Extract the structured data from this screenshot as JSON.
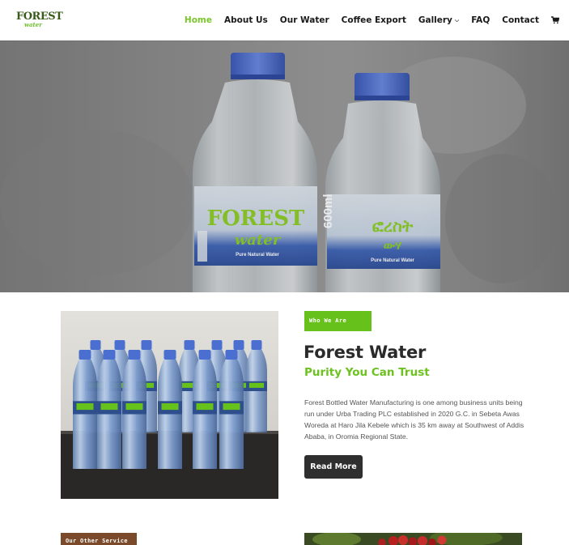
{
  "header": {
    "logo_main": "FOREST",
    "logo_sub": "water",
    "nav": [
      {
        "label": "Home",
        "active": true
      },
      {
        "label": "About Us"
      },
      {
        "label": "Our Water"
      },
      {
        "label": "Coffee Export"
      },
      {
        "label": "Gallery",
        "has_dropdown": true
      },
      {
        "label": "FAQ"
      },
      {
        "label": "Contact"
      }
    ],
    "cart_icon": "shopping-cart-icon"
  },
  "hero": {
    "bottle_label_left": "FOREST",
    "bottle_label_left_sub": "water",
    "bottle_caption": "Pure Natural Water",
    "bottle_label_right": "ፎረስት",
    "bottle_label_right_sub": "ውሃ",
    "bottle_volume": "600ml"
  },
  "about": {
    "tag": "Who We Are",
    "title": "Forest Water",
    "subtitle": "Purity You Can Trust",
    "body": "Forest Bottled Water Manufacturing is one among business units being run under Urba Trading PLC established in 2020 G.C. in Sebeta Awas Woreda at Haro Jila Kebele which is 35 km away at Southwest of Addis Ababa, in Oromia Regional State.",
    "button": "Read More"
  },
  "services": {
    "tag": "Our Other Service"
  },
  "colors": {
    "accent_green": "#66c21a",
    "dark_button": "#2f2f2f",
    "brown_tag": "#7a4a2a",
    "cap_blue": "#4a6fd0"
  }
}
